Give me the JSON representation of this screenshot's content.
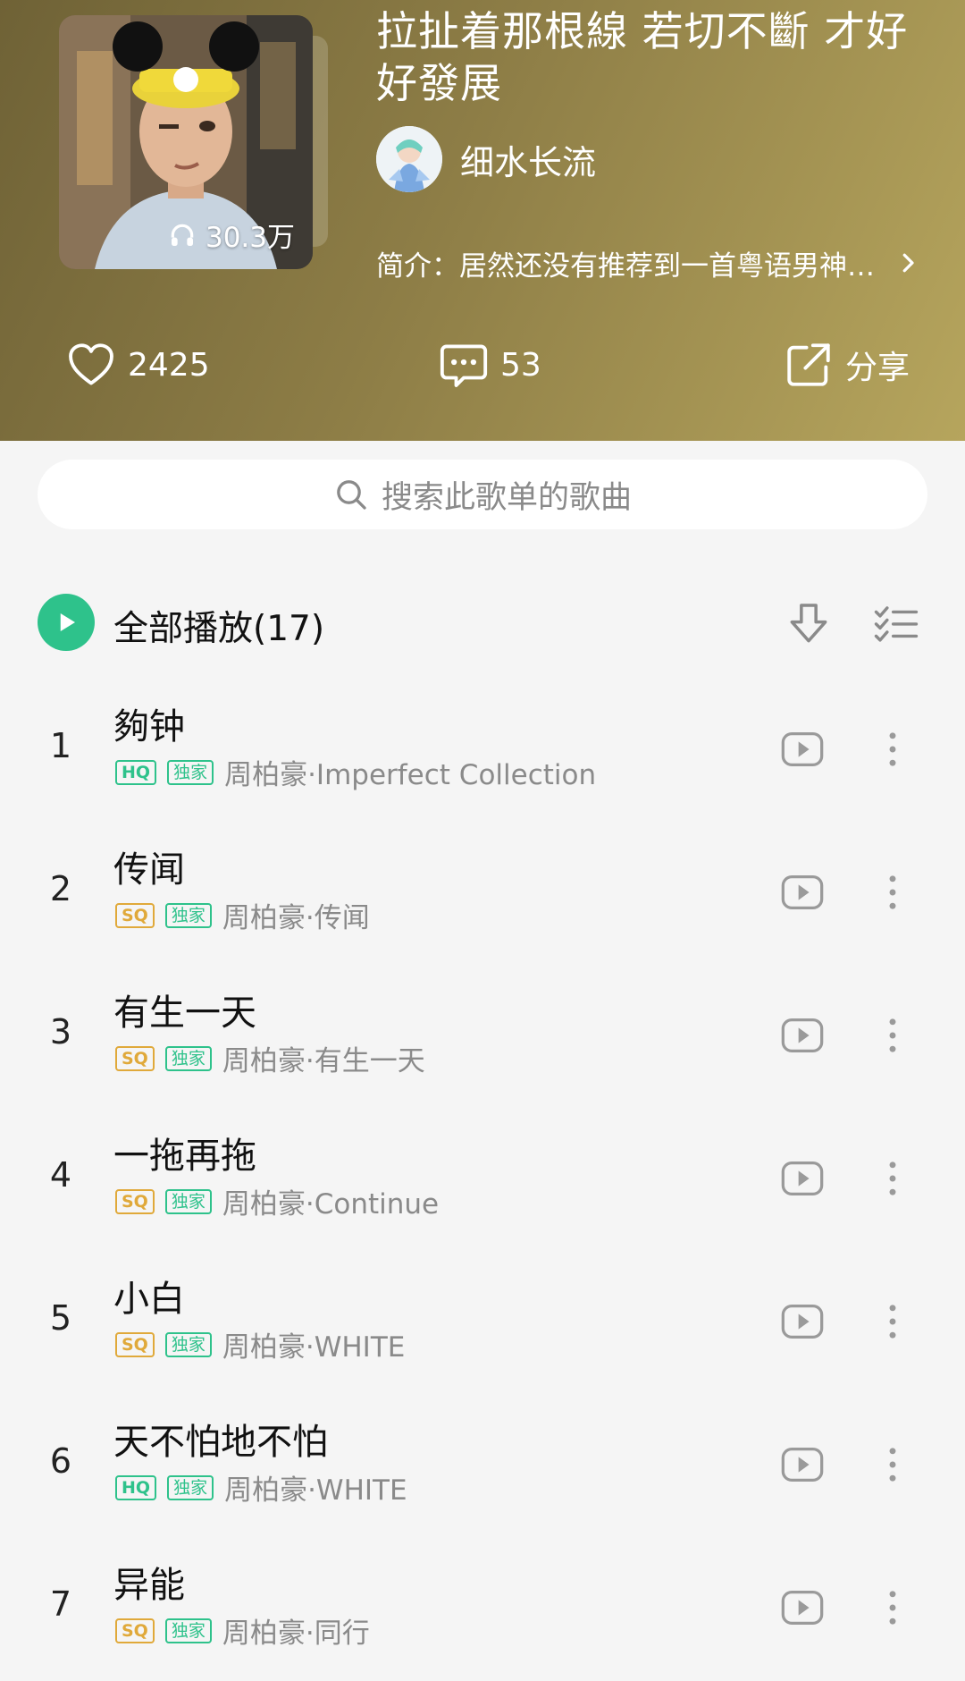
{
  "header": {
    "title": "拉扯着那根線 若切不斷 才好好發展",
    "play_count": "30.3万",
    "creator_name": "细水长流",
    "intro": "简介：居然还没有推荐到一首粤语男神…",
    "likes": "2425",
    "comments": "53",
    "share_label": "分享"
  },
  "search": {
    "placeholder": "搜索此歌单的歌曲"
  },
  "play_all": {
    "label": "全部播放(17)"
  },
  "songs": [
    {
      "index": "1",
      "title": "夠钟",
      "quality": "HQ",
      "exclusive": "独家",
      "artist_album": "周柏豪·Imperfect Collection"
    },
    {
      "index": "2",
      "title": "传闻",
      "quality": "SQ",
      "exclusive": "独家",
      "artist_album": "周柏豪·传闻"
    },
    {
      "index": "3",
      "title": "有生一天",
      "quality": "SQ",
      "exclusive": "独家",
      "artist_album": "周柏豪·有生一天"
    },
    {
      "index": "4",
      "title": "一拖再拖",
      "quality": "SQ",
      "exclusive": "独家",
      "artist_album": "周柏豪·Continue"
    },
    {
      "index": "5",
      "title": "小白",
      "quality": "SQ",
      "exclusive": "独家",
      "artist_album": "周柏豪·WHITE"
    },
    {
      "index": "6",
      "title": "天不怕地不怕",
      "quality": "HQ",
      "exclusive": "独家",
      "artist_album": "周柏豪·WHITE"
    },
    {
      "index": "7",
      "title": "异能",
      "quality": "SQ",
      "exclusive": "独家",
      "artist_album": "周柏豪·同行"
    }
  ],
  "colors": {
    "accent": "#2ec28b",
    "sq_badge": "#e0a93a",
    "header_bg": "#8d7d46"
  }
}
